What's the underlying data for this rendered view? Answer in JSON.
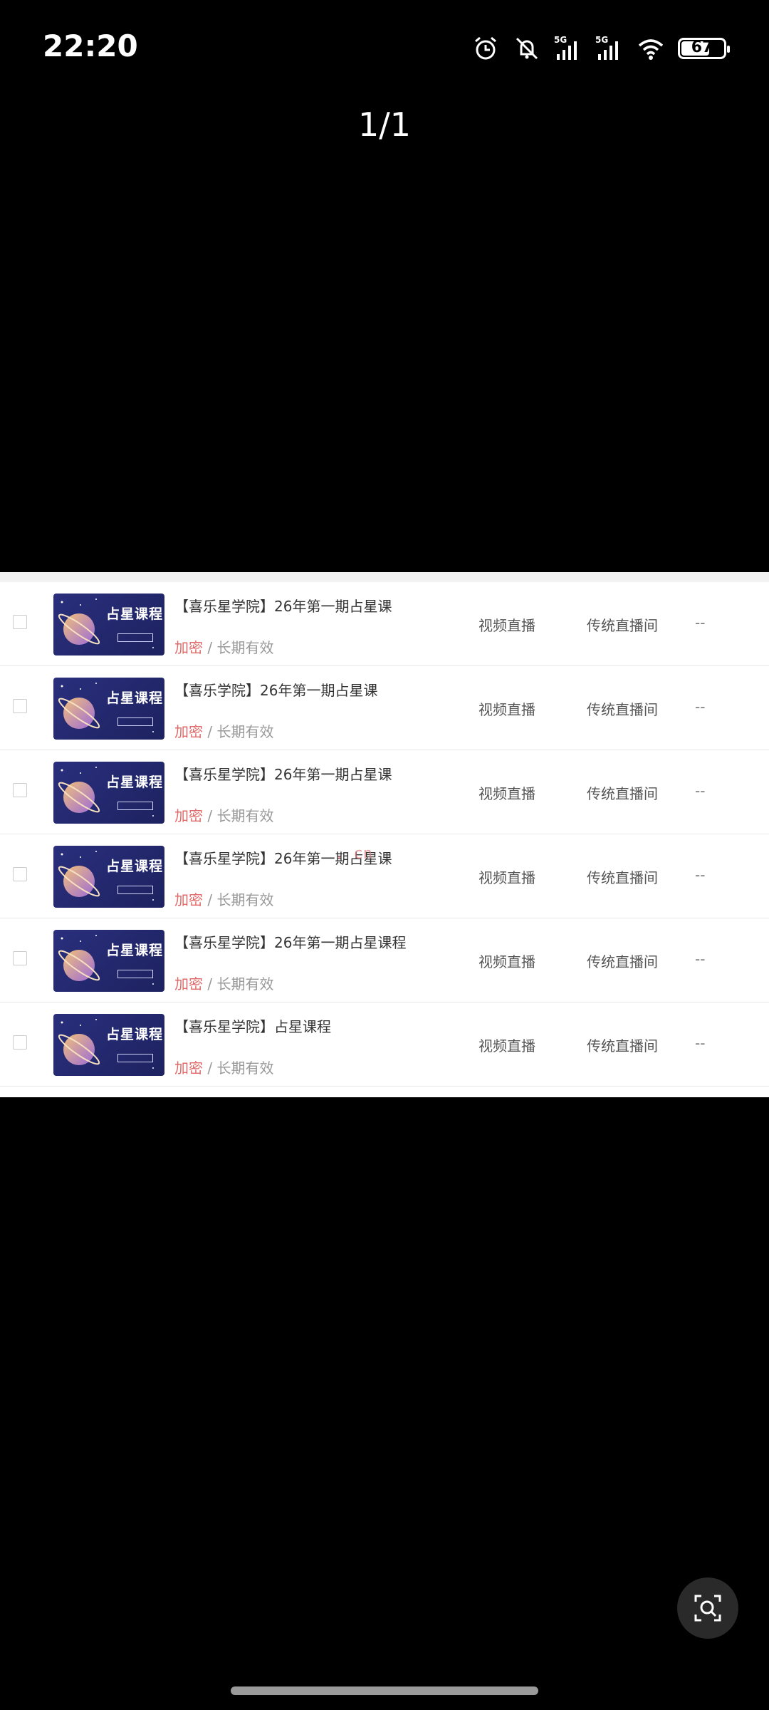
{
  "status_bar": {
    "time": "22:20",
    "battery": "67",
    "battery_level": 0.67,
    "icons": [
      "alarm-icon",
      "bell-muted-icon",
      "signal-5g-icon",
      "signal-5g-icon",
      "wifi-icon",
      "battery-icon"
    ],
    "network_label": "5G"
  },
  "viewer": {
    "page_counter": "1/1"
  },
  "table": {
    "rows": [
      {
        "thumb_title": "占星课程",
        "title": "【喜乐星学院】26年第一期占星课",
        "encrypt": "加密",
        "validity": "/ 长期有效",
        "type": "视频直播",
        "room": "传统直播间",
        "extra": "--"
      },
      {
        "thumb_title": "占星课程",
        "title": "【喜乐学院】26年第一期占星课",
        "encrypt": "加密",
        "validity": "/ 长期有效",
        "type": "视频直播",
        "room": "传统直播间",
        "extra": "--"
      },
      {
        "thumb_title": "占星课程",
        "title": "【喜乐星学院】26年第一期占星课",
        "encrypt": "加密",
        "validity": "/ 长期有效",
        "type": "视频直播",
        "room": "传统直播间",
        "extra": "--"
      },
      {
        "thumb_title": "占星课程",
        "title": "【喜乐星学院】26年第一期占星课",
        "encrypt": "加密",
        "validity": "/ 长期有效",
        "type": "视频直播",
        "room": "传统直播间",
        "extra": "--"
      },
      {
        "thumb_title": "占星课程",
        "title": "【喜乐星学院】26年第一期占星课程",
        "encrypt": "加密",
        "validity": "/ 长期有效",
        "type": "视频直播",
        "room": "传统直播间",
        "extra": "--"
      },
      {
        "thumb_title": "占星课程",
        "title": "【喜乐星学院】占星课程",
        "encrypt": "加密",
        "validity": "/ 长期有效",
        "type": "视频直播",
        "room": "传统直播间",
        "extra": "--"
      }
    ],
    "watermark": ". cn",
    "colors": {
      "encrypt": "#e06a6a",
      "thumb_bg": "#2a2f7d"
    }
  },
  "fab": {
    "icon": "search-scan-icon"
  }
}
